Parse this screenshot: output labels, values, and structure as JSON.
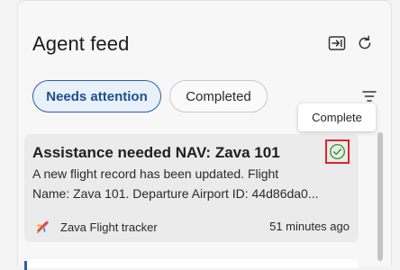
{
  "header": {
    "title": "Agent feed",
    "icons": [
      "open-panel-icon",
      "refresh-icon"
    ]
  },
  "filters": {
    "tabs": [
      {
        "label": "Needs attention",
        "selected": true
      },
      {
        "label": "Completed",
        "selected": false
      }
    ],
    "filter_icon": "filter-icon"
  },
  "tooltip": {
    "text": "Complete"
  },
  "feed": {
    "items": [
      {
        "title": "Assistance needed NAV: Zava 101",
        "description_line1": "A new flight record has been updated. Flight",
        "description_line2": "Name: Zava 101. Departure Airport ID: 44d86da0...",
        "source": "Zava Flight tracker",
        "time": "51 minutes ago",
        "status_icon": "check-circle-icon"
      }
    ]
  },
  "colors": {
    "accent": "#2c5fa3",
    "complete_green": "#3a9a3a",
    "highlight_red": "#d9262b"
  }
}
